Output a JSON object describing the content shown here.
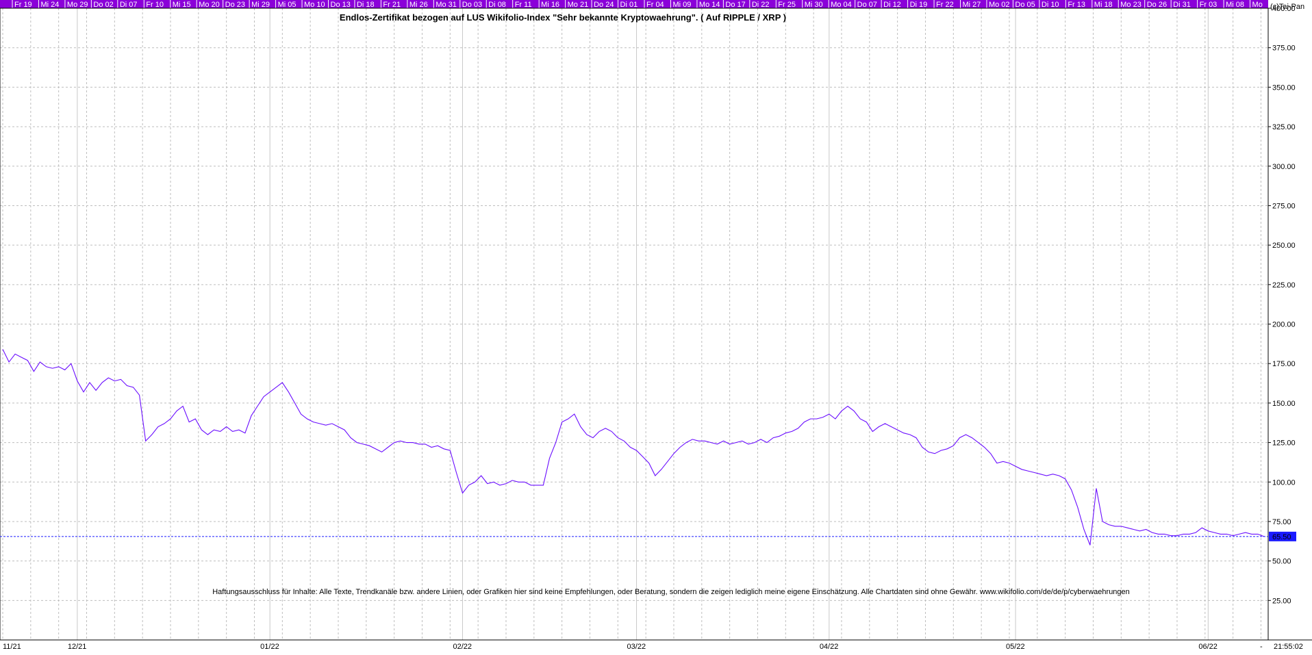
{
  "copyright": "(c)Tai-Pan",
  "colors": {
    "line": "#6a0dff",
    "top_band": "#8b00d9",
    "grid": "#bdbdbd",
    "last_label_bg": "#1a1aff"
  },
  "chart_data": {
    "type": "line",
    "title": "Endlos-Zertifikat bezogen auf LUS Wikifolio-Index \"Sehr bekannte Kryptowaehrung\". ( Auf RIPPLE / XRP )",
    "xlabel": "",
    "ylabel": "",
    "ylim": [
      0,
      400
    ],
    "y_ticks": [
      25,
      50,
      75,
      100,
      125,
      150,
      175,
      200,
      225,
      250,
      275,
      300,
      325,
      350,
      375,
      400
    ],
    "y_tick_labels": [
      "25.00",
      "50.00",
      "75.00",
      "100.00",
      "125.00",
      "150.00",
      "175.00",
      "200.00",
      "225.00",
      "250.00",
      "275.00",
      "300.00",
      "325.00",
      "350.00",
      "375.00",
      "400.00"
    ],
    "x_start": "2021-11-19",
    "x_end": "2022-06-10",
    "month_labels": [
      {
        "label": "11/21",
        "date": "2021-11-19"
      },
      {
        "label": "12/21",
        "date": "2021-12-01"
      },
      {
        "label": "01/22",
        "date": "2022-01-01"
      },
      {
        "label": "02/22",
        "date": "2022-02-01"
      },
      {
        "label": "03/22",
        "date": "2022-03-01"
      },
      {
        "label": "04/22",
        "date": "2022-04-01"
      },
      {
        "label": "05/22",
        "date": "2022-05-01"
      },
      {
        "label": "06/22",
        "date": "2022-06-01"
      }
    ],
    "top_labels": [
      "Fr 19",
      "Mi 24",
      "Mo 29",
      "Do 02",
      "Di 07",
      "Fr 10",
      "Mi 15",
      "Mo 20",
      "Do 23",
      "Mi 29",
      "Mi 05",
      "Mo 10",
      "Do 13",
      "Di 18",
      "Fr 21",
      "Mi 26",
      "Mo 31",
      "Do 03",
      "Di 08",
      "Fr 11",
      "Mi 16",
      "Mo 21",
      "Do 24",
      "Di 01",
      "Fr 04",
      "Mi 09",
      "Mo 14",
      "Do 17",
      "Di 22",
      "Fr 25",
      "Mi 30",
      "Mo 04",
      "Do 07",
      "Di 12",
      "Di 19",
      "Fr 22",
      "Mi 27",
      "Mo 02",
      "Do 05",
      "Di 10",
      "Fr 13",
      "Mi 18",
      "Mo 23",
      "Do 26",
      "Di 31",
      "Fr 03",
      "Mi 08",
      "Mo"
    ],
    "last_value": 65.5,
    "last_value_label": "65.50",
    "time_label": "21:55:02",
    "dash_label": "-",
    "grid": true,
    "series": [
      {
        "name": "",
        "points": [
          [
            "2021-11-19",
            184
          ],
          [
            "2021-11-20",
            176
          ],
          [
            "2021-11-21",
            181
          ],
          [
            "2021-11-22",
            179
          ],
          [
            "2021-11-23",
            177
          ],
          [
            "2021-11-24",
            170
          ],
          [
            "2021-11-25",
            176
          ],
          [
            "2021-11-26",
            173
          ],
          [
            "2021-11-27",
            172
          ],
          [
            "2021-11-28",
            173
          ],
          [
            "2021-11-29",
            171
          ],
          [
            "2021-11-30",
            175
          ],
          [
            "2021-12-01",
            164
          ],
          [
            "2021-12-02",
            157
          ],
          [
            "2021-12-03",
            163
          ],
          [
            "2021-12-04",
            158
          ],
          [
            "2021-12-05",
            163
          ],
          [
            "2021-12-06",
            166
          ],
          [
            "2021-12-07",
            164
          ],
          [
            "2021-12-08",
            165
          ],
          [
            "2021-12-09",
            161
          ],
          [
            "2021-12-10",
            160
          ],
          [
            "2021-12-11",
            155
          ],
          [
            "2021-12-12",
            126
          ],
          [
            "2021-12-13",
            130
          ],
          [
            "2021-12-14",
            135
          ],
          [
            "2021-12-15",
            137
          ],
          [
            "2021-12-16",
            140
          ],
          [
            "2021-12-17",
            145
          ],
          [
            "2021-12-18",
            148
          ],
          [
            "2021-12-19",
            138
          ],
          [
            "2021-12-20",
            140
          ],
          [
            "2021-12-21",
            133
          ],
          [
            "2021-12-22",
            130
          ],
          [
            "2021-12-23",
            133
          ],
          [
            "2021-12-24",
            132
          ],
          [
            "2021-12-25",
            135
          ],
          [
            "2021-12-26",
            132
          ],
          [
            "2021-12-27",
            133
          ],
          [
            "2021-12-28",
            131
          ],
          [
            "2021-12-29",
            142
          ],
          [
            "2021-12-30",
            148
          ],
          [
            "2021-12-31",
            154
          ],
          [
            "2022-01-01",
            157
          ],
          [
            "2022-01-02",
            160
          ],
          [
            "2022-01-03",
            163
          ],
          [
            "2022-01-04",
            157
          ],
          [
            "2022-01-05",
            150
          ],
          [
            "2022-01-06",
            143
          ],
          [
            "2022-01-07",
            140
          ],
          [
            "2022-01-08",
            138
          ],
          [
            "2022-01-09",
            137
          ],
          [
            "2022-01-10",
            136
          ],
          [
            "2022-01-11",
            137
          ],
          [
            "2022-01-12",
            135
          ],
          [
            "2022-01-13",
            133
          ],
          [
            "2022-01-14",
            128
          ],
          [
            "2022-01-15",
            125
          ],
          [
            "2022-01-16",
            124
          ],
          [
            "2022-01-17",
            123
          ],
          [
            "2022-01-18",
            121
          ],
          [
            "2022-01-19",
            119
          ],
          [
            "2022-01-20",
            122
          ],
          [
            "2022-01-21",
            125
          ],
          [
            "2022-01-22",
            126
          ],
          [
            "2022-01-23",
            125
          ],
          [
            "2022-01-24",
            125
          ],
          [
            "2022-01-25",
            124
          ],
          [
            "2022-01-26",
            124
          ],
          [
            "2022-01-27",
            122
          ],
          [
            "2022-01-28",
            123
          ],
          [
            "2022-01-29",
            121
          ],
          [
            "2022-01-30",
            120
          ],
          [
            "2022-01-31",
            106
          ],
          [
            "2022-02-01",
            93
          ],
          [
            "2022-02-02",
            98
          ],
          [
            "2022-02-03",
            100
          ],
          [
            "2022-02-04",
            104
          ],
          [
            "2022-02-05",
            99
          ],
          [
            "2022-02-06",
            100
          ],
          [
            "2022-02-07",
            98
          ],
          [
            "2022-02-08",
            99
          ],
          [
            "2022-02-09",
            101
          ],
          [
            "2022-02-10",
            100
          ],
          [
            "2022-02-11",
            100
          ],
          [
            "2022-02-12",
            98
          ],
          [
            "2022-02-13",
            98
          ],
          [
            "2022-02-14",
            98
          ],
          [
            "2022-02-15",
            115
          ],
          [
            "2022-02-16",
            125
          ],
          [
            "2022-02-17",
            138
          ],
          [
            "2022-02-18",
            140
          ],
          [
            "2022-02-19",
            143
          ],
          [
            "2022-02-20",
            135
          ],
          [
            "2022-02-21",
            130
          ],
          [
            "2022-02-22",
            128
          ],
          [
            "2022-02-23",
            132
          ],
          [
            "2022-02-24",
            134
          ],
          [
            "2022-02-25",
            132
          ],
          [
            "2022-02-26",
            128
          ],
          [
            "2022-02-27",
            126
          ],
          [
            "2022-02-28",
            122
          ],
          [
            "2022-03-01",
            120
          ],
          [
            "2022-03-02",
            116
          ],
          [
            "2022-03-03",
            112
          ],
          [
            "2022-03-04",
            104
          ],
          [
            "2022-03-05",
            108
          ],
          [
            "2022-03-06",
            113
          ],
          [
            "2022-03-07",
            118
          ],
          [
            "2022-03-08",
            122
          ],
          [
            "2022-03-09",
            125
          ],
          [
            "2022-03-10",
            127
          ],
          [
            "2022-03-11",
            126
          ],
          [
            "2022-03-12",
            126
          ],
          [
            "2022-03-13",
            125
          ],
          [
            "2022-03-14",
            124
          ],
          [
            "2022-03-15",
            126
          ],
          [
            "2022-03-16",
            124
          ],
          [
            "2022-03-17",
            125
          ],
          [
            "2022-03-18",
            126
          ],
          [
            "2022-03-19",
            124
          ],
          [
            "2022-03-20",
            125
          ],
          [
            "2022-03-21",
            127
          ],
          [
            "2022-03-22",
            125
          ],
          [
            "2022-03-23",
            128
          ],
          [
            "2022-03-24",
            129
          ],
          [
            "2022-03-25",
            131
          ],
          [
            "2022-03-26",
            132
          ],
          [
            "2022-03-27",
            134
          ],
          [
            "2022-03-28",
            138
          ],
          [
            "2022-03-29",
            140
          ],
          [
            "2022-03-30",
            140
          ],
          [
            "2022-03-31",
            141
          ],
          [
            "2022-04-01",
            143
          ],
          [
            "2022-04-02",
            140
          ],
          [
            "2022-04-03",
            145
          ],
          [
            "2022-04-04",
            148
          ],
          [
            "2022-04-05",
            145
          ],
          [
            "2022-04-06",
            140
          ],
          [
            "2022-04-07",
            138
          ],
          [
            "2022-04-08",
            132
          ],
          [
            "2022-04-09",
            135
          ],
          [
            "2022-04-10",
            137
          ],
          [
            "2022-04-11",
            135
          ],
          [
            "2022-04-12",
            133
          ],
          [
            "2022-04-13",
            131
          ],
          [
            "2022-04-14",
            130
          ],
          [
            "2022-04-15",
            128
          ],
          [
            "2022-04-16",
            122
          ],
          [
            "2022-04-17",
            119
          ],
          [
            "2022-04-18",
            118
          ],
          [
            "2022-04-19",
            120
          ],
          [
            "2022-04-20",
            121
          ],
          [
            "2022-04-21",
            123
          ],
          [
            "2022-04-22",
            128
          ],
          [
            "2022-04-23",
            130
          ],
          [
            "2022-04-24",
            128
          ],
          [
            "2022-04-25",
            125
          ],
          [
            "2022-04-26",
            122
          ],
          [
            "2022-04-27",
            118
          ],
          [
            "2022-04-28",
            112
          ],
          [
            "2022-04-29",
            113
          ],
          [
            "2022-04-30",
            112
          ],
          [
            "2022-05-01",
            110
          ],
          [
            "2022-05-02",
            108
          ],
          [
            "2022-05-03",
            107
          ],
          [
            "2022-05-04",
            106
          ],
          [
            "2022-05-05",
            105
          ],
          [
            "2022-05-06",
            104
          ],
          [
            "2022-05-07",
            105
          ],
          [
            "2022-05-08",
            104
          ],
          [
            "2022-05-09",
            102
          ],
          [
            "2022-05-10",
            95
          ],
          [
            "2022-05-11",
            84
          ],
          [
            "2022-05-12",
            70
          ],
          [
            "2022-05-13",
            60
          ],
          [
            "2022-05-14",
            96
          ],
          [
            "2022-05-15",
            75
          ],
          [
            "2022-05-16",
            73
          ],
          [
            "2022-05-17",
            72
          ],
          [
            "2022-05-18",
            72
          ],
          [
            "2022-05-19",
            71
          ],
          [
            "2022-05-20",
            70
          ],
          [
            "2022-05-21",
            69
          ],
          [
            "2022-05-22",
            70
          ],
          [
            "2022-05-23",
            68
          ],
          [
            "2022-05-24",
            67
          ],
          [
            "2022-05-25",
            67
          ],
          [
            "2022-05-26",
            66
          ],
          [
            "2022-05-27",
            66
          ],
          [
            "2022-05-28",
            67
          ],
          [
            "2022-05-29",
            67
          ],
          [
            "2022-05-30",
            68
          ],
          [
            "2022-05-31",
            71
          ],
          [
            "2022-06-01",
            69
          ],
          [
            "2022-06-02",
            68
          ],
          [
            "2022-06-03",
            67
          ],
          [
            "2022-06-04",
            67
          ],
          [
            "2022-06-05",
            66
          ],
          [
            "2022-06-06",
            67
          ],
          [
            "2022-06-07",
            68
          ],
          [
            "2022-06-08",
            67
          ],
          [
            "2022-06-09",
            67
          ],
          [
            "2022-06-10",
            65.5
          ]
        ]
      }
    ]
  },
  "disclaimer": "Haftungsausschluss für Inhalte: Alle Texte, Trendkanäle bzw. andere Linien, oder Grafiken hier sind keine Empfehlungen, oder Beratung, sondern die zeigen lediglich meine eigene Einschätzung. Alle Chartdaten sind ohne Gewähr.  www.wikifolio.com/de/de/p/cyberwaehrungen"
}
